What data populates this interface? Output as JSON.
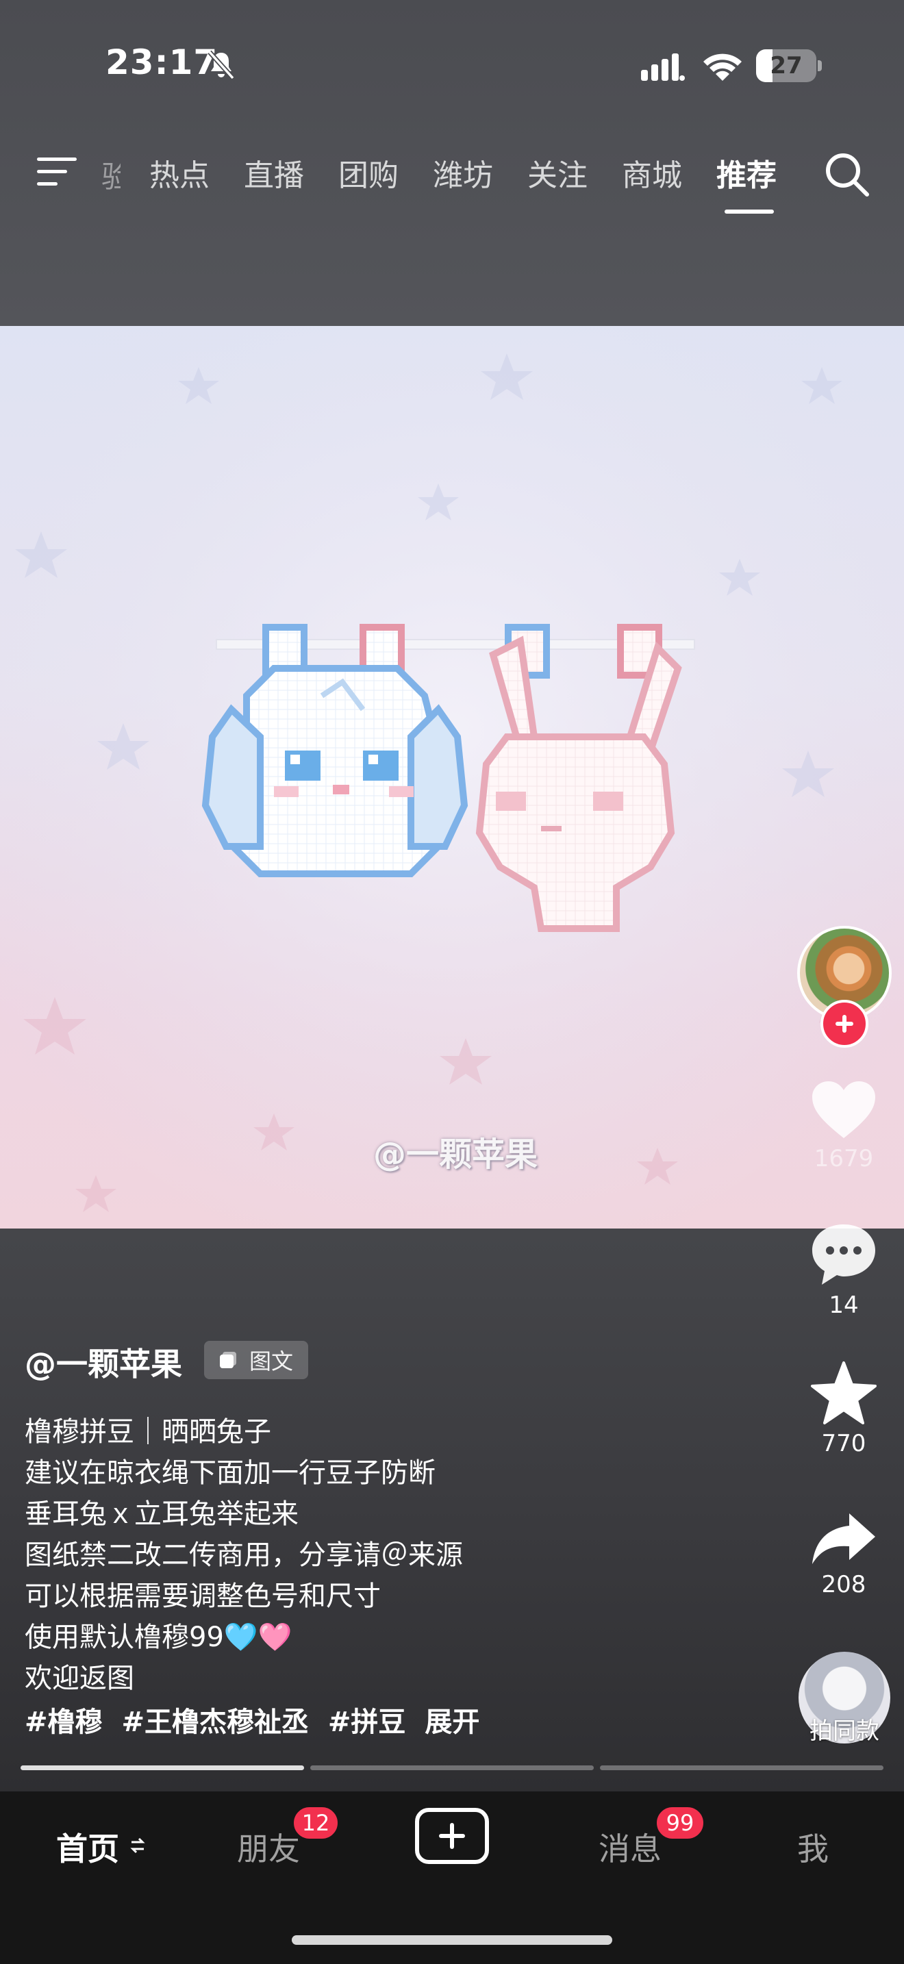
{
  "status_bar": {
    "time": "23:17",
    "battery_level": 27,
    "battery_label": "27"
  },
  "top_nav": {
    "partial_left": "验",
    "tabs": [
      {
        "label": "热点"
      },
      {
        "label": "直播"
      },
      {
        "label": "团购"
      },
      {
        "label": "潍坊"
      },
      {
        "label": "关注"
      },
      {
        "label": "商城"
      },
      {
        "label": "推荐",
        "active": true
      }
    ]
  },
  "post": {
    "watermark": "@一颗苹果",
    "author": "@一颗苹果",
    "type_badge": "图文",
    "caption_lines": [
      "橹穆拼豆｜晒晒兔子",
      "建议在晾衣绳下面加一行豆子防断",
      "垂耳兔ｘ立耳兔举起来",
      "图纸禁二改二传商用，分享请＠来源",
      "可以根据需要调整色号和尺寸",
      "使用默认橹穆99🩵🩷",
      "欢迎返图"
    ],
    "hashtags": [
      "#橹穆",
      "#王橹杰穆祉丞",
      "#拼豆"
    ],
    "expand_label": "展开",
    "page_count": 3,
    "current_page": 1
  },
  "actions": {
    "like_count": "1679",
    "comment_count": "14",
    "favorite_count": "770",
    "share_count": "208",
    "same_style_label": "拍同款"
  },
  "bottom_nav": {
    "home": "首页",
    "friends": "朋友",
    "friends_badge": "12",
    "messages": "消息",
    "messages_badge": "99",
    "me": "我"
  },
  "colors": {
    "accent_red": "#f2304e",
    "bottom_bar": "#161616"
  }
}
